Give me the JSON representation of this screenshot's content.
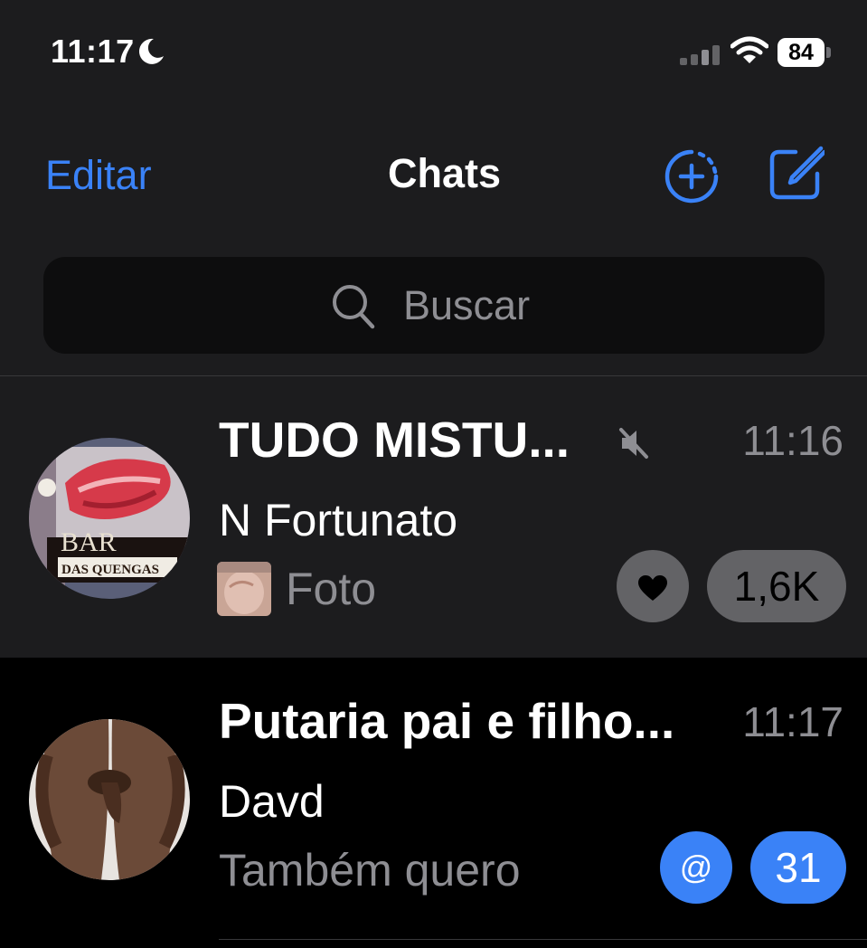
{
  "status_bar": {
    "time": "11:17",
    "battery": "84",
    "icons": [
      "moon-icon",
      "signal-icon",
      "wifi-icon",
      "battery-icon"
    ]
  },
  "nav": {
    "edit_label": "Editar",
    "title": "Chats",
    "icons": [
      "new-story-icon",
      "compose-icon"
    ]
  },
  "search": {
    "placeholder": "Buscar"
  },
  "chats": [
    {
      "name": "TUDO MISTU...",
      "time": "11:16",
      "sender": "N Fortunato",
      "preview": "Foto",
      "muted": true,
      "avatar_text": [
        "BAR",
        "DAS QUENGAS"
      ],
      "reaction_icon": "heart-icon",
      "unread": "1,6K"
    },
    {
      "name": "Putaria pai e filho...",
      "time": "11:17",
      "sender": "Davd",
      "preview": "Também quero",
      "muted": false,
      "mention": "@",
      "unread": "31"
    }
  ],
  "colors": {
    "accent": "#3a82f7",
    "background": "#1c1c1e",
    "secondary_text": "#8e8e93",
    "muted_badge": "#636366"
  }
}
